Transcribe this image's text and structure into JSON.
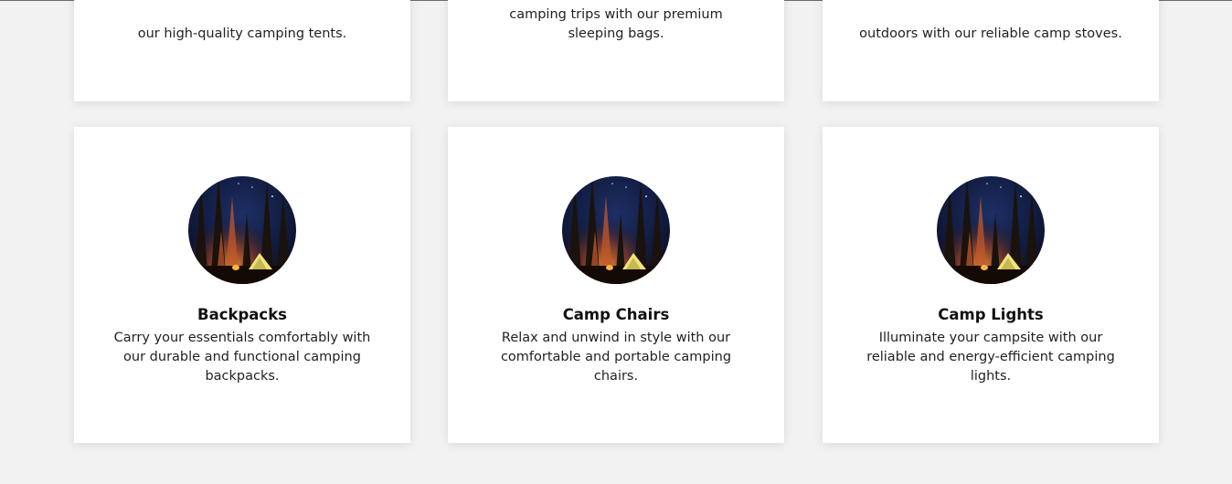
{
  "top_row": [
    {
      "description": "our high-quality camping tents."
    },
    {
      "description": "camping trips with our premium sleeping bags."
    },
    {
      "description": "outdoors with our reliable camp stoves."
    }
  ],
  "products": [
    {
      "title": "Backpacks",
      "description": "Carry your essentials comfortably with our durable and functional camping backpacks.",
      "image_icon": "camping-night-tent-photo"
    },
    {
      "title": "Camp Chairs",
      "description": "Relax and unwind in style with our comfortable and portable camping chairs.",
      "image_icon": "camping-night-tent-photo"
    },
    {
      "title": "Camp Lights",
      "description": "Illuminate your campsite with our reliable and energy-efficient camping lights.",
      "image_icon": "camping-night-tent-photo"
    }
  ],
  "colors": {
    "page_background": "#f2f2f2",
    "card_background": "#ffffff",
    "title_text": "#111111",
    "body_text": "#222222"
  }
}
